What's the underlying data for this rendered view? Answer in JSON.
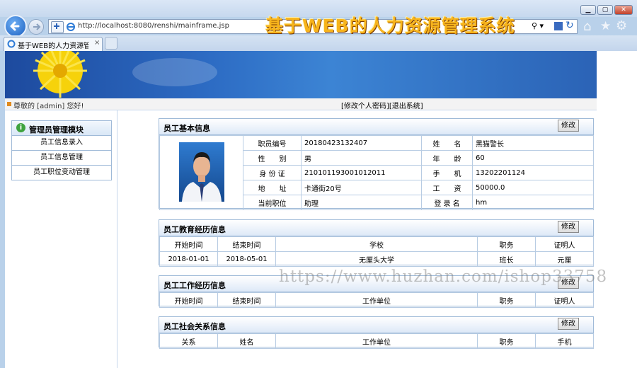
{
  "browser": {
    "url": "http://localhost:8080/renshi/mainframe.jsp",
    "tab_title": "基于WEB的人力资源管...",
    "tab_close": "×",
    "url_prefix_icon": "page-icon"
  },
  "header": {
    "banner_title": "基于WEB的人力资源管理系统",
    "greeting": "尊敬的 [admin] 您好!",
    "link_change_password": "[修改个人密码]",
    "link_logout": "[退出系统]"
  },
  "sidebar": {
    "title": "管理员管理模块",
    "items": [
      {
        "label": "员工信息录入"
      },
      {
        "label": "员工信息管理"
      },
      {
        "label": "员工职位变动管理"
      }
    ]
  },
  "basic_info": {
    "title": "员工基本信息",
    "edit": "修改",
    "fields": {
      "emp_no_label": "职员编号",
      "emp_no": "20180423132407",
      "name_label": "姓　　名",
      "name": "黑猫警长",
      "gender_label": "性　　别",
      "gender": "男",
      "age_label": "年　　龄",
      "age": "60",
      "id_label": "身 份 证",
      "id_no": "210101193001012011",
      "phone_label": "手　　机",
      "phone": "13202201124",
      "address_label": "地　　址",
      "address": "卡通街20号",
      "salary_label": "工　　资",
      "salary": "50000.0",
      "position_label": "当前职位",
      "position": "助理",
      "login_label": "登 录 名",
      "login": "hm"
    }
  },
  "education": {
    "title": "员工教育经历信息",
    "edit": "修改",
    "headers": [
      "开始时间",
      "结束时间",
      "学校",
      "职务",
      "证明人"
    ],
    "rows": [
      [
        "2018-01-01",
        "2018-05-01",
        "无厘头大学",
        "班长",
        "元厘"
      ]
    ]
  },
  "work": {
    "title": "员工工作经历信息",
    "edit": "修改",
    "headers": [
      "开始时间",
      "结束时间",
      "工作单位",
      "职务",
      "证明人"
    ]
  },
  "social": {
    "title": "员工社会关系信息",
    "edit": "修改",
    "headers": [
      "关系",
      "姓名",
      "工作单位",
      "职务",
      "手机"
    ]
  },
  "watermark": "https://www.huzhan.com/ishop33758",
  "colors": {
    "accent_border": "#9fbad8",
    "banner_title": "#f7b41c",
    "panel_header": "#dde9f7"
  }
}
